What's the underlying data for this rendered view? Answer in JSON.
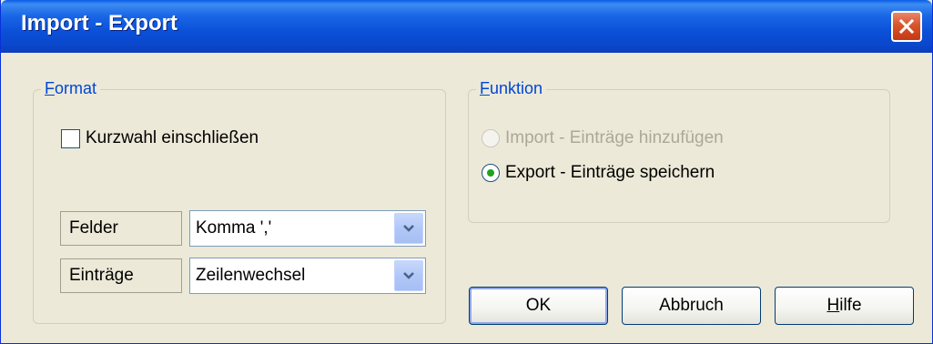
{
  "window": {
    "title": "Import - Export"
  },
  "format": {
    "legend_accel": "F",
    "legend_rest": "ormat",
    "include_shortcuts_label": "Kurzwahl einschließen",
    "include_shortcuts_checked": false,
    "fields_label": "Felder",
    "fields_value": "Komma ','",
    "entries_label": "Einträge",
    "entries_value": "Zeilenwechsel"
  },
  "funktion": {
    "legend_accel": "F",
    "legend_rest": "unktion",
    "import_label": "Import - Einträge hinzufügen",
    "import_enabled": false,
    "export_label": "Export - Einträge speichern",
    "export_selected": true
  },
  "buttons": {
    "ok_label": "OK",
    "cancel_label": "Abbruch",
    "help_accel": "H",
    "help_rest": "ilfe"
  },
  "colors": {
    "titlebar": "#0a50d8",
    "dialog_bg": "#ece9d8",
    "legend_text": "#0046d5",
    "radio_dot": "#21a121",
    "close_button": "#d9542b"
  }
}
